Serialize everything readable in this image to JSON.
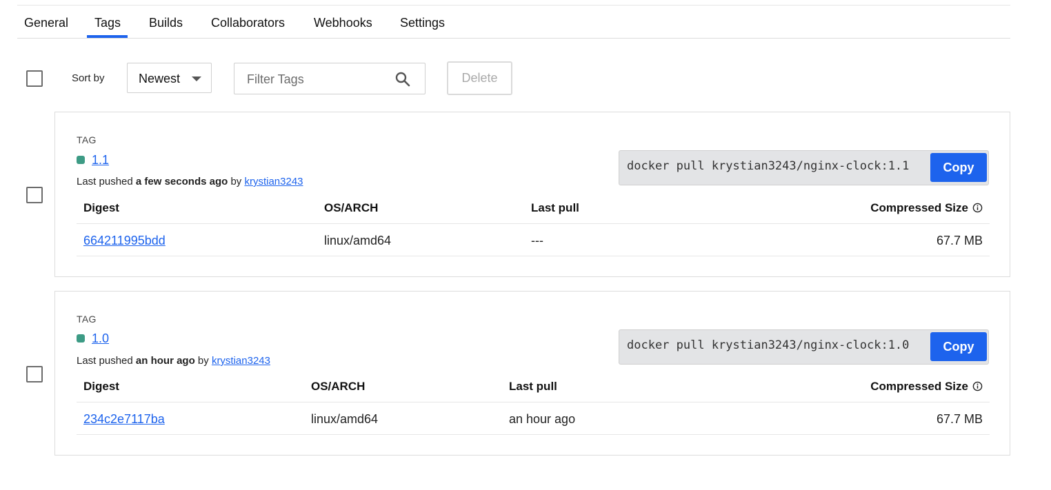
{
  "tabs": [
    {
      "label": "General"
    },
    {
      "label": "Tags",
      "active": true
    },
    {
      "label": "Builds"
    },
    {
      "label": "Collaborators"
    },
    {
      "label": "Webhooks"
    },
    {
      "label": "Settings"
    }
  ],
  "toolbar": {
    "sort_label": "Sort by",
    "sort_value": "Newest",
    "filter_placeholder": "Filter Tags",
    "delete_label": "Delete"
  },
  "colors": {
    "accent": "#1d63ed",
    "tag_status": "#3d9b85"
  },
  "tags": [
    {
      "section_label": "TAG",
      "name": "1.1",
      "pushed_prefix": "Last pushed",
      "pushed_time": "a few seconds ago",
      "pushed_by": "by",
      "user": "krystian3243",
      "pull_command": "docker pull krystian3243/nginx-clock:1.1",
      "copy_label": "Copy",
      "columns": {
        "digest": "Digest",
        "osarch": "OS/ARCH",
        "last_pull": "Last pull",
        "size": "Compressed Size"
      },
      "rows": [
        {
          "digest": "664211995bdd",
          "osarch": "linux/amd64",
          "last_pull": "---",
          "size": "67.7 MB"
        }
      ]
    },
    {
      "section_label": "TAG",
      "name": "1.0",
      "pushed_prefix": "Last pushed",
      "pushed_time": "an hour ago",
      "pushed_by": "by",
      "user": "krystian3243",
      "pull_command": "docker pull krystian3243/nginx-clock:1.0",
      "copy_label": "Copy",
      "columns": {
        "digest": "Digest",
        "osarch": "OS/ARCH",
        "last_pull": "Last pull",
        "size": "Compressed Size"
      },
      "rows": [
        {
          "digest": "234c2e7117ba",
          "osarch": "linux/amd64",
          "last_pull": "an hour ago",
          "size": "67.7 MB"
        }
      ]
    }
  ]
}
